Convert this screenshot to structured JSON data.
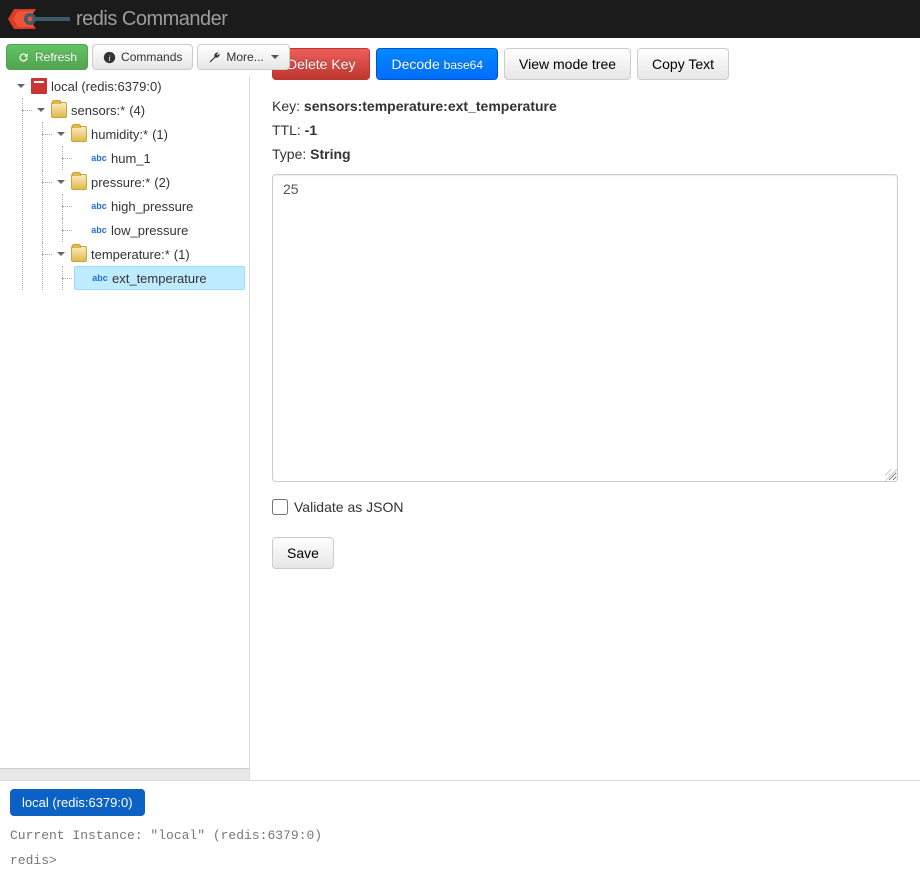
{
  "header": {
    "title": "redis Commander"
  },
  "toolbar": {
    "refresh": "Refresh",
    "commands": "Commands",
    "more": "More..."
  },
  "tree": {
    "root": {
      "label": "local (redis:6379:0)",
      "sensors": {
        "label": "sensors:*",
        "count": "(4)"
      },
      "humidity": {
        "label": "humidity:*",
        "count": "(1)"
      },
      "hum_1": "hum_1",
      "pressure": {
        "label": "pressure:*",
        "count": "(2)"
      },
      "high_pressure": "high_pressure",
      "low_pressure": "low_pressure",
      "temperature": {
        "label": "temperature:*",
        "count": "(1)"
      },
      "ext_temperature": "ext_temperature"
    }
  },
  "actions": {
    "delete": "Delete Key",
    "decode": "Decode",
    "decode_sub": "base64",
    "view_mode": "View mode tree",
    "copy_text": "Copy Text"
  },
  "detail": {
    "key_label": "Key:",
    "key_value": "sensors:temperature:ext_temperature",
    "ttl_label": "TTL:",
    "ttl_value": "-1",
    "type_label": "Type:",
    "type_value": "String",
    "value": "25",
    "validate_label": "Validate as JSON",
    "save": "Save"
  },
  "footer": {
    "instance_tab": "local (redis:6379:0)",
    "current": "Current Instance: \"local\" (redis:6379:0)",
    "prompt": "redis>"
  }
}
